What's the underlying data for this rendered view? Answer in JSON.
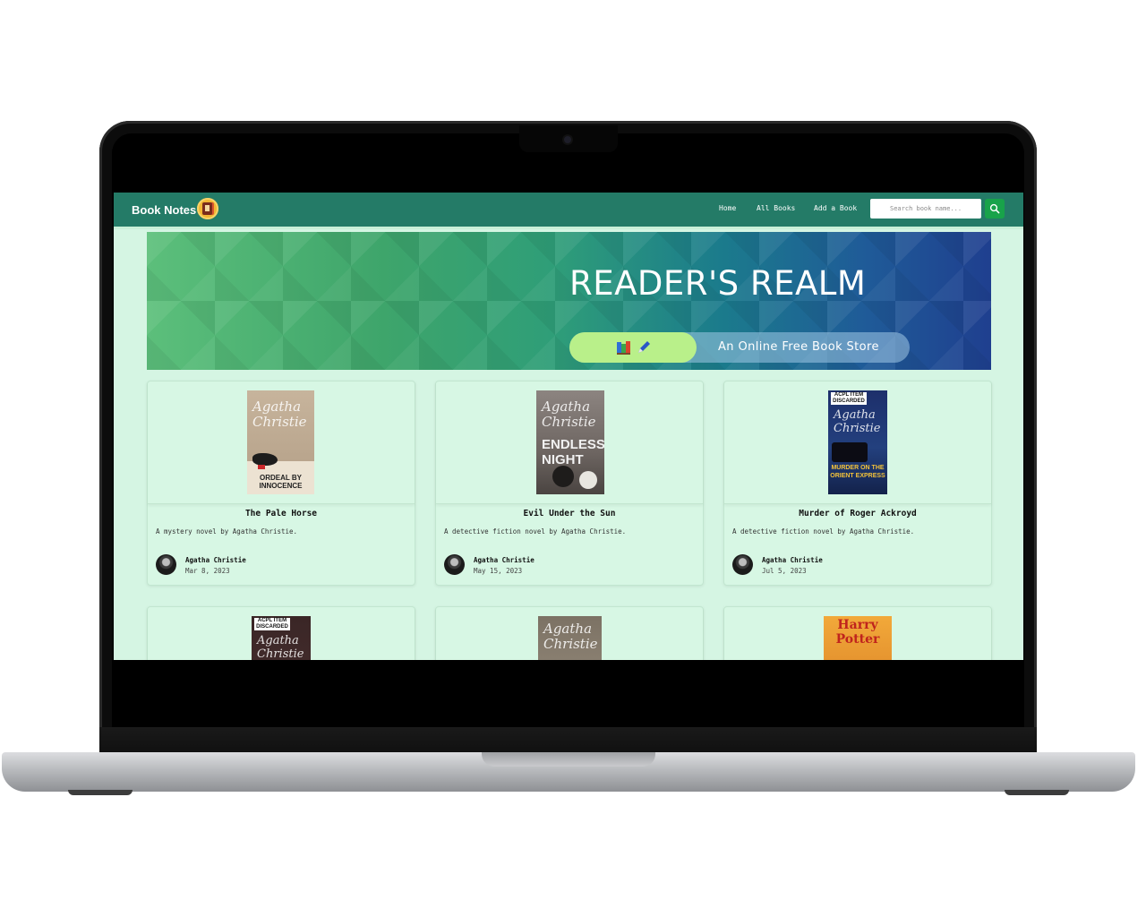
{
  "navbar": {
    "brand": "Book Notes",
    "links": [
      "Home",
      "All Books",
      "Add a Book"
    ],
    "search_placeholder": "Search book name..."
  },
  "hero": {
    "title": "READER'S REALM",
    "tagline": "An Online Free Book Store"
  },
  "covers": {
    "c1": {
      "script": "Agatha Christie",
      "caption": "ORDEAL BY INNOCENCE"
    },
    "c2": {
      "script": "Agatha Christie",
      "caption": "ENDLESS NIGHT"
    },
    "c3": {
      "badge": "ACPL ITEM DISCARDED",
      "script": "Agatha Christie",
      "caption": "MURDER ON THE ORIENT EXPRESS"
    },
    "c4": {
      "badge": "ACPL ITEM DISCARDED",
      "script": "Agatha Christie"
    },
    "c5": {
      "script": "Agatha Christie"
    },
    "c6": {
      "script": "Harry Potter"
    }
  },
  "books": [
    {
      "title": "The Pale Horse",
      "description": "A mystery novel by Agatha Christie.",
      "author": "Agatha Christie",
      "date": "Mar 8, 2023"
    },
    {
      "title": "Evil Under the Sun",
      "description": "A detective fiction novel by Agatha Christie.",
      "author": "Agatha Christie",
      "date": "May 15, 2023"
    },
    {
      "title": "Murder of Roger Ackroyd",
      "description": "A detective fiction novel by Agatha Christie.",
      "author": "Agatha Christie",
      "date": "Jul 5, 2023"
    }
  ],
  "colors": {
    "navbar": "#247b67",
    "page_background": "#d5f5e3",
    "search_button": "#18a34a",
    "pill_highlight": "#b9f08a"
  },
  "icons": {
    "search": "search-icon",
    "books": "books-icon",
    "pen": "pen-icon"
  }
}
